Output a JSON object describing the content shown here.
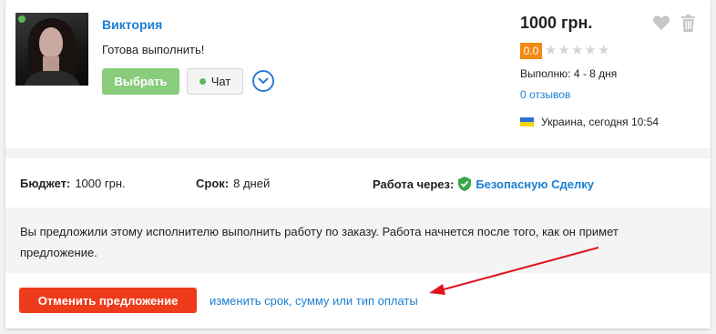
{
  "offer": {
    "name": "Виктория",
    "message": "Готова выполнить!",
    "choose_label": "Выбрать",
    "chat_label": "Чат",
    "price": "1000 грн.",
    "rating": "0.0",
    "stars_count": 5,
    "perform_time": "Выполню: 4 - 8 дня",
    "reviews": "0 отзывов",
    "location": "Украина, сегодня 10:54"
  },
  "details": {
    "budget_label": "Бюджет:",
    "budget_value": "1000 грн.",
    "term_label": "Срок:",
    "term_value": "8 дней",
    "work_label": "Работа через:",
    "work_link": "Безопасную Сделку"
  },
  "notice": {
    "text": "Вы предложили этому исполнителю выполнить работу по заказу. Работа начнется после того, как он примет предложение."
  },
  "actions": {
    "cancel_label": "Отменить предложение",
    "change_link": "изменить срок, сумму или тип оплаты"
  },
  "colors": {
    "link": "#1b7fd3",
    "choose_button": "#88cc7c",
    "cancel_button": "#ee3b1b",
    "rating_badge": "#f08a14",
    "online": "#5cb85c",
    "arrow": "#e0141e"
  },
  "icons": [
    "heart-icon",
    "trash-icon",
    "star-icon",
    "chevron-down-icon",
    "shield-check-icon",
    "ukraine-flag-icon",
    "online-dot-icon"
  ]
}
